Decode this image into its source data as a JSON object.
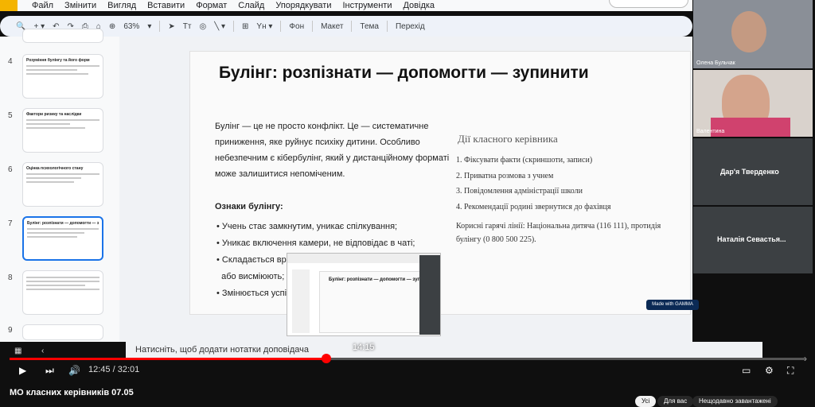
{
  "menu": [
    "Файл",
    "Змінити",
    "Вигляд",
    "Вставити",
    "Формат",
    "Слайд",
    "Упорядкувати",
    "Інструменти",
    "Довідка"
  ],
  "toolbar": {
    "zoom": "63%",
    "bg": "Фон",
    "layout": "Макет",
    "theme": "Тема",
    "transition": "Перехід"
  },
  "slides": [
    {
      "num": "4",
      "title": "Розуміння булінгу та його форм"
    },
    {
      "num": "5",
      "title": "Фактори ризику та наслідки"
    },
    {
      "num": "6",
      "title": "Оцінка психологічного стану"
    },
    {
      "num": "7",
      "title": "Булінг: розпізнати — допомогти — зупинити"
    },
    {
      "num": "8",
      "title": ""
    },
    {
      "num": "9",
      "title": ""
    }
  ],
  "slide": {
    "title": "Булінг: розпізнати — допомогти — зупинити",
    "para": [
      "Булінг — це не просто конфлікт. Це — систематичне",
      "приниження, яке руйнує психіку дитини. Особливо",
      "небезпечним є кібербулінг, який у дистанційному форматі",
      "може залишитися непоміченим."
    ],
    "signs_heading": "Ознаки булінгу:",
    "signs": [
      "Учень стає замкнутим, уникає спілкування;",
      "Уникає включення камери, не відповідає в чаті;",
      "Складається вра",
      "або висміюють;",
      "Змінюється успі"
    ],
    "actions_heading": "Дії класного керівника",
    "actions": [
      "1.  Фіксувати факти (скриншоти, записи)",
      "2.  Приватна розмова з учнем",
      "3.  Повідомлення адміністрації школи",
      "4.  Рекомендації родині звернутися до фахівця"
    ],
    "hotline": [
      "Корисні гарячі лінії: Національна дитяча (116 111), протидія",
      "булінгу (0 800 500 225)."
    ],
    "badge": "Made with GAMMA"
  },
  "notes": "Натисніть, щоб додати нотатки доповідача",
  "participants": [
    {
      "name": "Олена Бульчак"
    },
    {
      "name": "Валентина"
    },
    {
      "name": "Дар'я Тверденко"
    },
    {
      "name": "Наталія Севастья..."
    }
  ],
  "player": {
    "current": "12:45",
    "duration": "32:01",
    "hover_time": "14:15",
    "progress": 0.398,
    "title": "МО класних керівників 07.05",
    "chips": [
      "Усі",
      "Для вас",
      "Нещодавно завантажені"
    ]
  }
}
